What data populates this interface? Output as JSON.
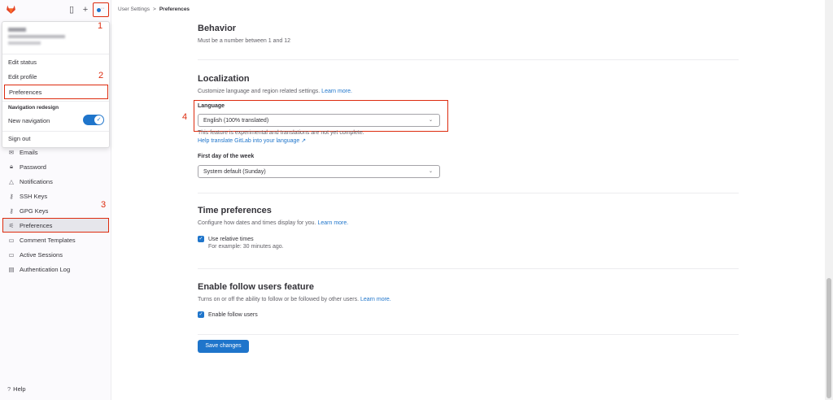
{
  "colors": {
    "accent": "#1f75cb",
    "annotation": "#dd2b0e",
    "logo": "#e24329"
  },
  "annotations": [
    "1",
    "2",
    "3",
    "4"
  ],
  "topbar": {
    "breadcrumb": [
      "User Settings",
      "Preferences"
    ],
    "separator": ">"
  },
  "dropdown": {
    "items": [
      "Edit status",
      "Edit profile",
      "Preferences"
    ],
    "section_heading": "Navigation redesign",
    "toggle_label": "New navigation",
    "toggle_on": true,
    "sign_out": "Sign out"
  },
  "sidebar": {
    "items": [
      {
        "icon": "mail-icon",
        "label": "Emails"
      },
      {
        "icon": "lock-icon",
        "label": "Password"
      },
      {
        "icon": "bell-icon",
        "label": "Notifications"
      },
      {
        "icon": "key-icon",
        "label": "SSH Keys"
      },
      {
        "icon": "key-icon",
        "label": "GPG Keys"
      },
      {
        "icon": "preferences-icon",
        "label": "Preferences"
      },
      {
        "icon": "comment-icon",
        "label": "Comment Templates"
      },
      {
        "icon": "monitor-icon",
        "label": "Active Sessions"
      },
      {
        "icon": "log-icon",
        "label": "Authentication Log"
      }
    ],
    "help": "Help"
  },
  "behavior": {
    "title": "Behavior",
    "hint": "Must be a number between 1 and 12"
  },
  "localization": {
    "title": "Localization",
    "desc": "Customize language and region related settings.",
    "learn_more": "Learn more.",
    "language_label": "Language",
    "language_value": "English (100% translated)",
    "experimental_note": "This feature is experimental and translations are not yet complete.",
    "help_translate": "Help translate GitLab into your language",
    "first_day_label": "First day of the week",
    "first_day_value": "System default (Sunday)"
  },
  "time_prefs": {
    "title": "Time preferences",
    "desc": "Configure how dates and times display for you.",
    "learn_more": "Learn more.",
    "checkbox_label": "Use relative times",
    "checked": true,
    "example": "For example: 30 minutes ago."
  },
  "follow": {
    "title": "Enable follow users feature",
    "desc": "Turns on or off the ability to follow or be followed by other users.",
    "learn_more": "Learn more.",
    "checkbox_label": "Enable follow users",
    "checked": true
  },
  "save_button": "Save changes"
}
